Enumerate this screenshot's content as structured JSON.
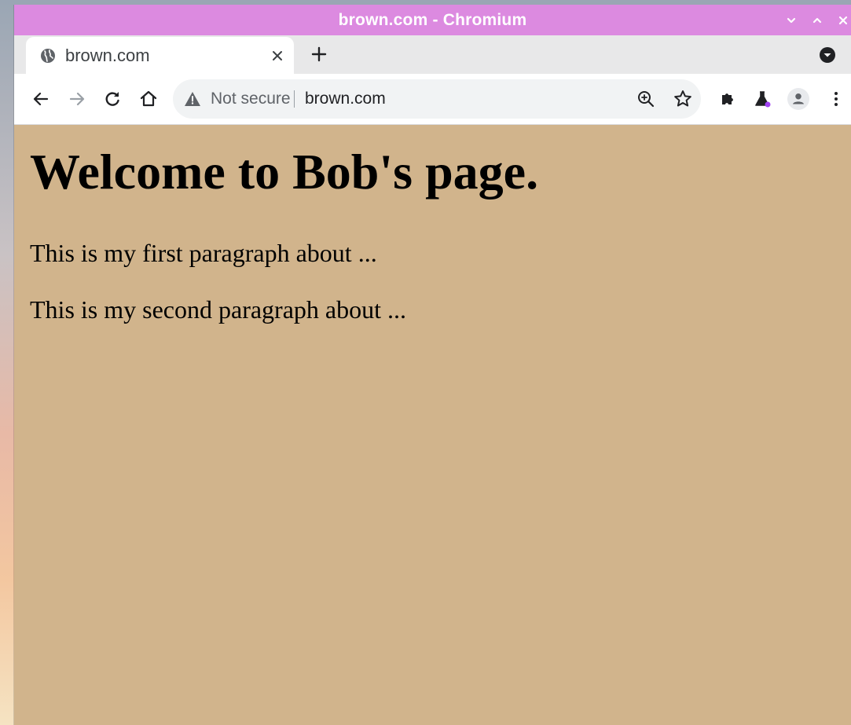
{
  "window": {
    "title": "brown.com - Chromium",
    "titlebar_color": "#dc8ae0",
    "controls": [
      "minimize",
      "maximize",
      "close"
    ]
  },
  "tab": {
    "title": "brown.com",
    "favicon": "globe-icon"
  },
  "omnibox": {
    "security_label": "Not secure",
    "url": "brown.com"
  },
  "page": {
    "background_color": "#d1b48c",
    "heading": "Welcome to Bob's page.",
    "paragraphs": [
      "This is my first paragraph about ...",
      "This is my second paragraph about ..."
    ]
  }
}
